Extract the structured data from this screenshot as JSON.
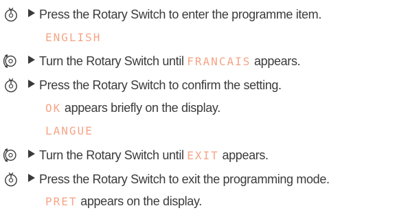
{
  "icons": {
    "push": "rotary-switch-push-icon",
    "turn": "rotary-switch-turn-icon"
  },
  "colors": {
    "text": "#3a3a3a",
    "display": "#f5a586"
  },
  "lines": {
    "l1": {
      "text": "Press the Rotary Switch to enter the programme item."
    },
    "l2": {
      "display": "ENGLISH"
    },
    "l3": {
      "before": "Turn the Rotary Switch until ",
      "display": "FRANCAIS",
      "after": " appears."
    },
    "l4": {
      "text": "Press the Rotary Switch to confirm the setting."
    },
    "l5": {
      "display": "OK",
      "after": " appears briefly on the display."
    },
    "l6": {
      "display": "LANGUE"
    },
    "l7": {
      "before": "Turn the Rotary Switch until ",
      "display": "EXIT",
      "after": " appears."
    },
    "l8": {
      "text": "Press the Rotary Switch to exit the programming mode."
    },
    "l9": {
      "display": "PRET",
      "after": " appears on the display."
    }
  }
}
